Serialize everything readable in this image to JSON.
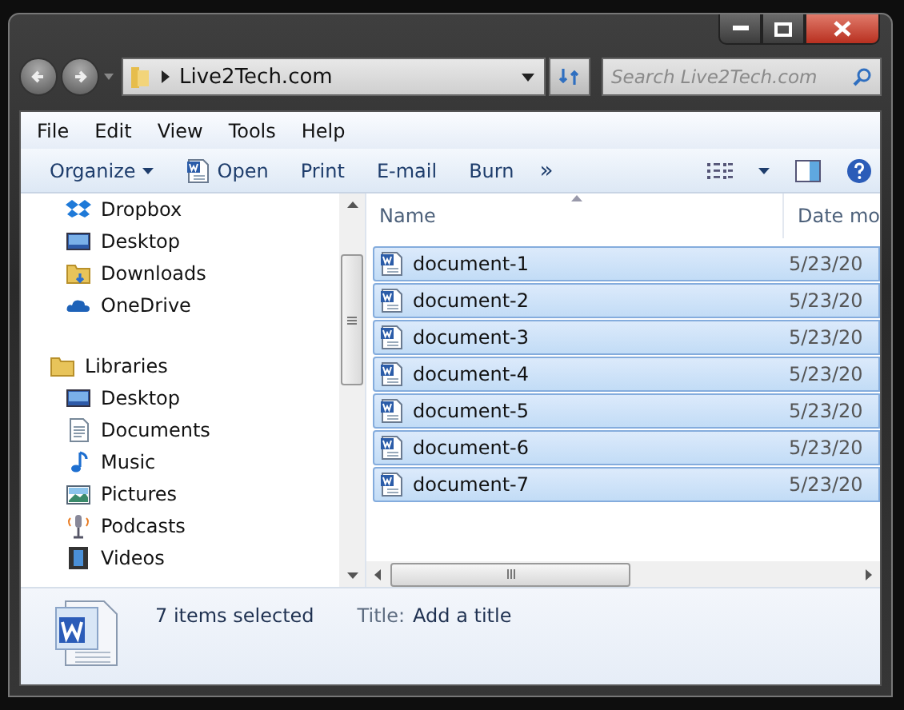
{
  "window": {
    "address": "Live2Tech.com",
    "search": {
      "placeholder": "Search Live2Tech.com"
    }
  },
  "menu": [
    "File",
    "Edit",
    "View",
    "Tools",
    "Help"
  ],
  "toolbar": [
    {
      "label": "Organize",
      "kind": "dropdown"
    },
    {
      "label": "Open",
      "kind": "word"
    },
    {
      "label": "Print",
      "kind": "plain"
    },
    {
      "label": "E-mail",
      "kind": "plain"
    },
    {
      "label": "Burn",
      "kind": "plain"
    },
    {
      "label": "»",
      "kind": "more"
    }
  ],
  "nav": [
    {
      "label": "Dropbox",
      "kind": "dropbox"
    },
    {
      "label": "Desktop",
      "kind": "desktop"
    },
    {
      "label": "Downloads",
      "kind": "downloads"
    },
    {
      "label": "OneDrive",
      "kind": "cloud"
    },
    {
      "label": "Libraries",
      "kind": "library",
      "children": [
        {
          "label": "Desktop",
          "kind": "libdesktop"
        },
        {
          "label": "Documents",
          "kind": "documents"
        },
        {
          "label": "Music",
          "kind": "music"
        },
        {
          "label": "Pictures",
          "kind": "pictures"
        },
        {
          "label": "Podcasts",
          "kind": "podcasts"
        },
        {
          "label": "Videos",
          "kind": "videos"
        }
      ]
    }
  ],
  "columns": [
    "Name",
    "Date mo"
  ],
  "files": [
    {
      "name": "document-1",
      "date": "5/23/20",
      "selected": true
    },
    {
      "name": "document-2",
      "date": "5/23/20",
      "selected": true
    },
    {
      "name": "document-3",
      "date": "5/23/20",
      "selected": true
    },
    {
      "name": "document-4",
      "date": "5/23/20",
      "selected": true
    },
    {
      "name": "document-5",
      "date": "5/23/20",
      "selected": true
    },
    {
      "name": "document-6",
      "date": "5/23/20",
      "selected": true
    },
    {
      "name": "document-7",
      "date": "5/23/20",
      "selected": true
    }
  ],
  "details": {
    "summary": "7 items selected",
    "field_label": "Title:",
    "field_value": "Add a title"
  }
}
